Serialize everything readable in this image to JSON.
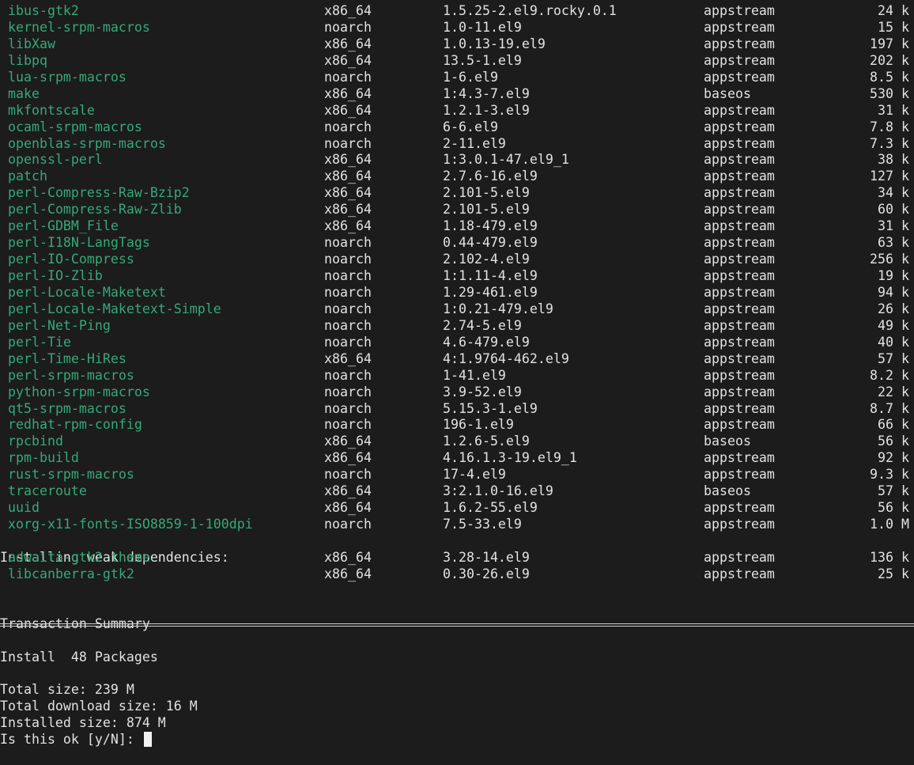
{
  "packages": [
    {
      "name": "ibus-gtk2",
      "arch": "x86_64",
      "version": "1.5.25-2.el9.rocky.0.1",
      "repo": "appstream",
      "size": "24 k"
    },
    {
      "name": "kernel-srpm-macros",
      "arch": "noarch",
      "version": "1.0-11.el9",
      "repo": "appstream",
      "size": "15 k"
    },
    {
      "name": "libXaw",
      "arch": "x86_64",
      "version": "1.0.13-19.el9",
      "repo": "appstream",
      "size": "197 k"
    },
    {
      "name": "libpq",
      "arch": "x86_64",
      "version": "13.5-1.el9",
      "repo": "appstream",
      "size": "202 k"
    },
    {
      "name": "lua-srpm-macros",
      "arch": "noarch",
      "version": "1-6.el9",
      "repo": "appstream",
      "size": "8.5 k"
    },
    {
      "name": "make",
      "arch": "x86_64",
      "version": "1:4.3-7.el9",
      "repo": "baseos",
      "size": "530 k"
    },
    {
      "name": "mkfontscale",
      "arch": "x86_64",
      "version": "1.2.1-3.el9",
      "repo": "appstream",
      "size": "31 k"
    },
    {
      "name": "ocaml-srpm-macros",
      "arch": "noarch",
      "version": "6-6.el9",
      "repo": "appstream",
      "size": "7.8 k"
    },
    {
      "name": "openblas-srpm-macros",
      "arch": "noarch",
      "version": "2-11.el9",
      "repo": "appstream",
      "size": "7.3 k"
    },
    {
      "name": "openssl-perl",
      "arch": "x86_64",
      "version": "1:3.0.1-47.el9_1",
      "repo": "appstream",
      "size": "38 k"
    },
    {
      "name": "patch",
      "arch": "x86_64",
      "version": "2.7.6-16.el9",
      "repo": "appstream",
      "size": "127 k"
    },
    {
      "name": "perl-Compress-Raw-Bzip2",
      "arch": "x86_64",
      "version": "2.101-5.el9",
      "repo": "appstream",
      "size": "34 k"
    },
    {
      "name": "perl-Compress-Raw-Zlib",
      "arch": "x86_64",
      "version": "2.101-5.el9",
      "repo": "appstream",
      "size": "60 k"
    },
    {
      "name": "perl-GDBM_File",
      "arch": "x86_64",
      "version": "1.18-479.el9",
      "repo": "appstream",
      "size": "31 k"
    },
    {
      "name": "perl-I18N-LangTags",
      "arch": "noarch",
      "version": "0.44-479.el9",
      "repo": "appstream",
      "size": "63 k"
    },
    {
      "name": "perl-IO-Compress",
      "arch": "noarch",
      "version": "2.102-4.el9",
      "repo": "appstream",
      "size": "256 k"
    },
    {
      "name": "perl-IO-Zlib",
      "arch": "noarch",
      "version": "1:1.11-4.el9",
      "repo": "appstream",
      "size": "19 k"
    },
    {
      "name": "perl-Locale-Maketext",
      "arch": "noarch",
      "version": "1.29-461.el9",
      "repo": "appstream",
      "size": "94 k"
    },
    {
      "name": "perl-Locale-Maketext-Simple",
      "arch": "noarch",
      "version": "1:0.21-479.el9",
      "repo": "appstream",
      "size": "26 k"
    },
    {
      "name": "perl-Net-Ping",
      "arch": "noarch",
      "version": "2.74-5.el9",
      "repo": "appstream",
      "size": "49 k"
    },
    {
      "name": "perl-Tie",
      "arch": "noarch",
      "version": "4.6-479.el9",
      "repo": "appstream",
      "size": "40 k"
    },
    {
      "name": "perl-Time-HiRes",
      "arch": "x86_64",
      "version": "4:1.9764-462.el9",
      "repo": "appstream",
      "size": "57 k"
    },
    {
      "name": "perl-srpm-macros",
      "arch": "noarch",
      "version": "1-41.el9",
      "repo": "appstream",
      "size": "8.2 k"
    },
    {
      "name": "python-srpm-macros",
      "arch": "noarch",
      "version": "3.9-52.el9",
      "repo": "appstream",
      "size": "22 k"
    },
    {
      "name": "qt5-srpm-macros",
      "arch": "noarch",
      "version": "5.15.3-1.el9",
      "repo": "appstream",
      "size": "8.7 k"
    },
    {
      "name": "redhat-rpm-config",
      "arch": "noarch",
      "version": "196-1.el9",
      "repo": "appstream",
      "size": "66 k"
    },
    {
      "name": "rpcbind",
      "arch": "x86_64",
      "version": "1.2.6-5.el9",
      "repo": "baseos",
      "size": "56 k"
    },
    {
      "name": "rpm-build",
      "arch": "x86_64",
      "version": "4.16.1.3-19.el9_1",
      "repo": "appstream",
      "size": "92 k"
    },
    {
      "name": "rust-srpm-macros",
      "arch": "noarch",
      "version": "17-4.el9",
      "repo": "appstream",
      "size": "9.3 k"
    },
    {
      "name": "traceroute",
      "arch": "x86_64",
      "version": "3:2.1.0-16.el9",
      "repo": "baseos",
      "size": "57 k"
    },
    {
      "name": "uuid",
      "arch": "x86_64",
      "version": "1.6.2-55.el9",
      "repo": "appstream",
      "size": "56 k"
    },
    {
      "name": "xorg-x11-fonts-ISO8859-1-100dpi",
      "arch": "noarch",
      "version": "7.5-33.el9",
      "repo": "appstream",
      "size": "1.0 M"
    }
  ],
  "weak_heading": "Installing weak dependencies:",
  "weak_packages": [
    {
      "name": "adwaita-gtk2-theme",
      "arch": "x86_64",
      "version": "3.28-14.el9",
      "repo": "appstream",
      "size": "136 k"
    },
    {
      "name": "libcanberra-gtk2",
      "arch": "x86_64",
      "version": "0.30-26.el9",
      "repo": "appstream",
      "size": "25 k"
    }
  ],
  "summary": {
    "heading": "Transaction Summary",
    "install_line": "Install  48 Packages",
    "total_size": "Total size: 239 M",
    "download_size": "Total download size: 16 M",
    "installed_size": "Installed size: 874 M",
    "prompt": "Is this ok [y/N]: "
  },
  "colors": {
    "background": "#1c1c1c",
    "text": "#e2e2e2",
    "package_name": "#35a87a"
  }
}
